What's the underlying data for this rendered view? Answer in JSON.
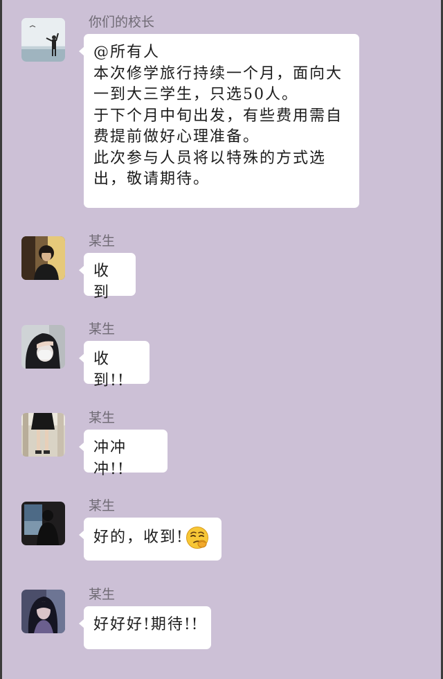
{
  "messages": [
    {
      "sender": "你们的校长",
      "avatar_icon": "person-at-sea-avatar",
      "text": "@所有人\n本次修学旅行持续一个月，面向大一到大三学生，只选50人。\n于下个月中旬出发，有些费用需自费提前做好心理准备。\n此次参与人员将以特殊的方式选出，敬请期待。"
    },
    {
      "sender": "某生",
      "avatar_icon": "boy-portrait-avatar",
      "text": "收到"
    },
    {
      "sender": "某生",
      "avatar_icon": "masked-girl-avatar",
      "text": "收到!!"
    },
    {
      "sender": "某生",
      "avatar_icon": "legs-in-skirt-avatar",
      "text": "冲冲冲!!"
    },
    {
      "sender": "某生",
      "avatar_icon": "silhouette-window-avatar",
      "text": "好的，收到!",
      "emoji": "smirk-face-emoji"
    },
    {
      "sender": "某生",
      "avatar_icon": "girl-long-hair-avatar",
      "text": "好好好!期待!!"
    }
  ],
  "colors": {
    "background": "#ccc0d6",
    "bubble": "#ffffff",
    "sender_text": "#6f6a74",
    "message_text": "#1c1c1c"
  }
}
